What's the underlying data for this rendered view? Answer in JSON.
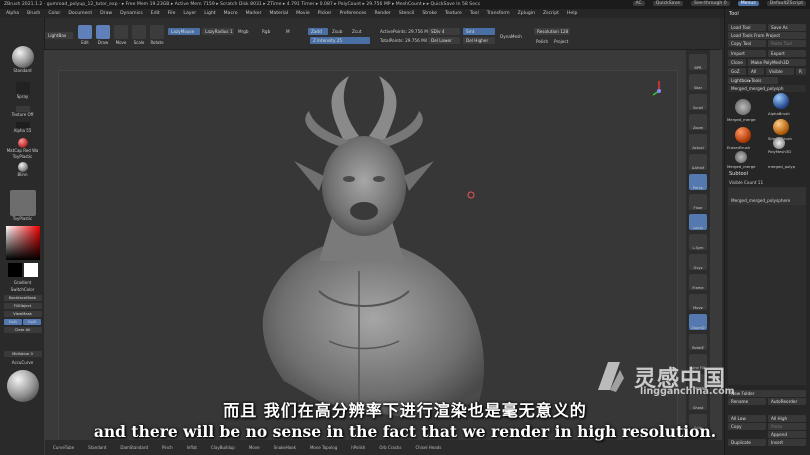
{
  "titlebar": {
    "text": "ZBrush 2021.1.2 · gumroad_polyup_12_tutor_exp · ▸ Free Mem 19.23GB ▸ Active Mem 7159 ▸ Scratch Disk 8031 ▸ ZTime ▸ 4.791 Timer ▸ 0.087 ▸ PolyCount ▸ 29.756 MP ▸ MeshCount ▸ ▸ QuickSave In 58 Secs",
    "ac": "AC",
    "quicksave": "QuickSave",
    "see_through": "See-through 0",
    "menus": "Menus",
    "script": "DefaultZScript"
  },
  "menubar": [
    "Alpha",
    "Brush",
    "Color",
    "Document",
    "Draw",
    "Dynamics",
    "Edit",
    "File",
    "Layer",
    "Light",
    "Macro",
    "Marker",
    "Material",
    "Movie",
    "Picker",
    "Preferences",
    "Render",
    "Stencil",
    "Stroke",
    "Texture",
    "Tool",
    "Transform",
    "Zplugin",
    "Zscript",
    "Help"
  ],
  "toolbar": {
    "projection_master": "Projection Master",
    "lightbox": "LightBox",
    "edit": "Edit",
    "draw": "Draw",
    "move": "Move",
    "scale": "Scale",
    "rotate": "Rotate",
    "lazymouse": "LazyMouse",
    "lazy_radius": "LazyRadius 1",
    "mrgb": "Mrgb",
    "rgb": "Rgb",
    "m": "M",
    "zadd": "Zadd",
    "zsub": "Zsub",
    "zcut": "Zcut",
    "z_intensity": "Z Intensity 25",
    "active_points": "ActivePoints: 29.756 Mil",
    "total_points": "TotalPoints: 29.756 Mil",
    "sdiv": "SDiv 4",
    "del_lower": "Del Lower",
    "smt": "Smt",
    "del_higher": "Del Higher",
    "dynamesh": "DynaMesh",
    "resolution": "Resolution 128",
    "polish": "Polish",
    "project": "Project"
  },
  "leftshelf": {
    "standard": "Standard",
    "spray": "Spray",
    "texture_off": "Texture Off",
    "alpha": "Alpha 55",
    "matcap": "MatCap Red Wa",
    "toy_plastic": "ToyPlastic",
    "blinn": "Blinn",
    "toy_plastic2": "ToyPlastic",
    "gradient": "Gradient",
    "switch_color": "SwitchColor",
    "backface_mask": "BackfaceMask",
    "fill_object": "FillObject",
    "view_mask": "ViewMask",
    "col1": "Col1",
    "col2": "Col2",
    "clear_all": "Clear All",
    "mid_value": "MidValue 0",
    "accu_curve": "AccuCurve"
  },
  "righticons": [
    "BPR",
    "Sbar",
    "Scroll",
    "Zoom",
    "Actual",
    "AAHalf",
    "Persp",
    "Floor",
    "Local",
    "L.Sym",
    "Gxyz",
    "Frame",
    "Move",
    "ZoomD",
    "RotatE",
    "Line Fill",
    "Transp",
    "Ghost",
    "Solo"
  ],
  "rightpanel": {
    "title": "Tool",
    "load_tool": "Load Tool",
    "save_as": "Save As",
    "load_tools_from_project": "Load Tools From Project",
    "copy_tool": "Copy Tool",
    "paste_tool": "Paste Tool",
    "import": "Import",
    "export": "Export",
    "clone": "Clone",
    "make_polymesh": "Make PolyMesh3D",
    "goz": "GoZ",
    "all": "All",
    "visible": "Visible",
    "r": "R",
    "lightbox_tools": "Lightbox▸Tools",
    "current_tool": "Merged_merged_polysph",
    "tools": [
      "Merged_merge",
      "AlphaBrush",
      "SimpleBrush",
      "EraserBrush",
      "PolyMesh3D",
      "Merged_merge",
      "merged_polyp"
    ],
    "subtool": "Subtool",
    "visible_count": "Visible Count 11",
    "subtool_item": "Merged_merged_polysphere",
    "new_folder": "New Folder",
    "rename": "Rename",
    "autoreorder": "AutoReorder",
    "all_low": "All Low",
    "all_high": "All High",
    "copy": "Copy",
    "paste": "Paste",
    "append": "Append",
    "duplicate": "Duplicate",
    "insert": "Insert"
  },
  "bottombar": [
    "CurveTube",
    "Standard",
    "DamStandard",
    "Pinch",
    "Inflat",
    "ClayBuildup",
    "Move",
    "SnakeHook",
    "Move Topolog",
    "hPolish",
    "Orb Cracks",
    "Chisel Heads"
  ],
  "subtitle": {
    "cn": "而且 我们在高分辨率下进行渲染也是毫无意义的",
    "en": "and there will be no sense in the fact that we render in high resolution."
  },
  "watermark": {
    "cn": "灵感中国",
    "en": "lingganchina.com"
  },
  "colors": {
    "accent": "#5478b0",
    "viewport_bg": "#373737",
    "model": "#8c8c8c"
  }
}
